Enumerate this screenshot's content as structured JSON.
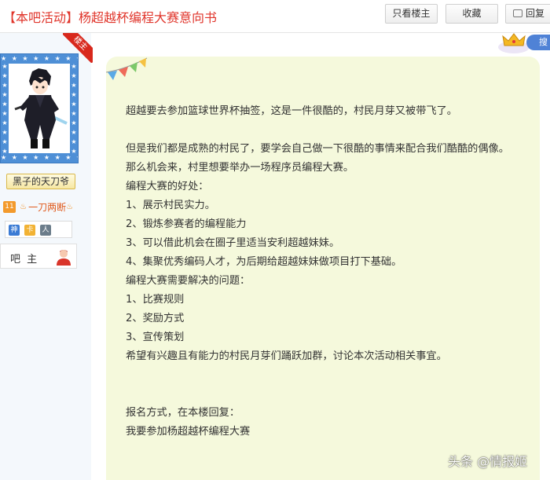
{
  "header": {
    "title": "【本吧活动】杨超越杯编程大赛意向书",
    "only_op_label": "只看楼主",
    "favorite_label": "收藏",
    "reply_label": "回复"
  },
  "author": {
    "op_tag": "楼主",
    "username": "黑子的天刀爷",
    "level_badge": "11",
    "level_name": "一刀两断",
    "role": "吧 主",
    "badges": [
      "神",
      "卡",
      "人"
    ]
  },
  "float_tab": {
    "search_label": "搜"
  },
  "post": {
    "lines": [
      "超越要去参加篮球世界杯抽签，这是一件很酷的，村民月芽又被带飞了。",
      "",
      "但是我们都是成熟的村民了，要学会自己做一下很酷的事情来配合我们酷酷的偶像。",
      "那么机会来，村里想要举办一场程序员编程大赛。",
      "编程大赛的好处：",
      "1、展示村民实力。",
      "2、锻炼参赛者的编程能力",
      "3、可以借此机会在圈子里适当安利超越妹妹。",
      "4、集聚优秀编码人才，为后期给超越妹妹做项目打下基础。",
      "编程大赛需要解决的问题：",
      "1、比赛规则",
      "2、奖励方式",
      "3、宣传策划",
      "希望有兴趣且有能力的村民月芽们踊跃加群，讨论本次活动相关事宜。",
      "",
      "",
      "报名方式，在本楼回复：",
      "我要参加杨超越杯编程大赛"
    ]
  },
  "watermark": "头条 @情报姬",
  "colors": {
    "title_red": "#e0352b",
    "bubble_bg": "#f5f9dc",
    "sidebar_bg": "#f4f8fc",
    "avatar_frame": "#4e8fd6",
    "op_ribbon": "#d8281c"
  }
}
